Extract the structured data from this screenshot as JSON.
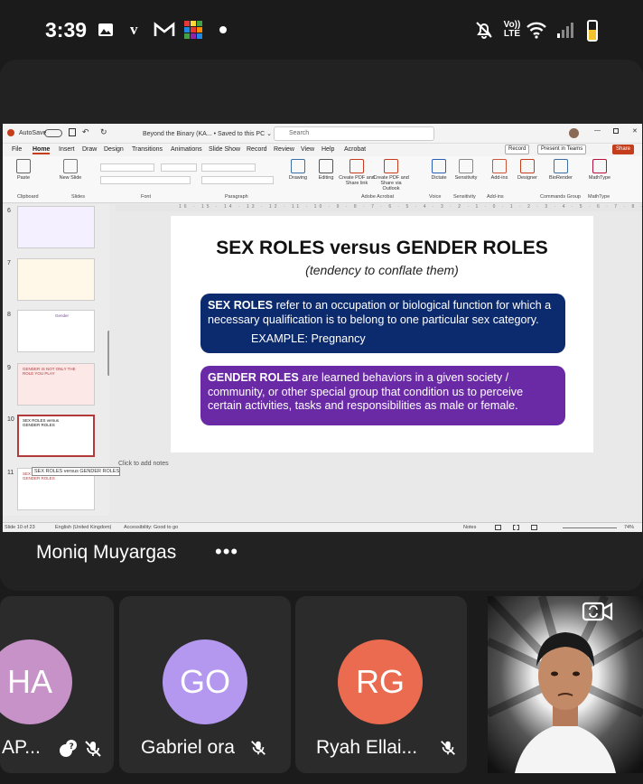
{
  "status_bar": {
    "time": "3:39",
    "indicators": [
      "gallery-icon",
      "v",
      "gmail-icon",
      "app-icon",
      "dot"
    ],
    "right": [
      "mute-icon",
      "VoLTE",
      "wifi-icon",
      "signal-icon",
      "battery-icon"
    ],
    "volte": "Vo)) LTE",
    "v_label": "v",
    "battery_level": 0.55
  },
  "shared_screen": {
    "titlebar": {
      "autosave": "AutoSave",
      "doc_title": "Beyond the Binary (KA... • Saved to this PC ⌄",
      "search_placeholder": "Search"
    },
    "menu": [
      "File",
      "Home",
      "Insert",
      "Draw",
      "Design",
      "Transitions",
      "Animations",
      "Slide Show",
      "Record",
      "Review",
      "View",
      "Help",
      "Acrobat"
    ],
    "menu_active": "Home",
    "menu_right": [
      "Record",
      "Present in Teams",
      "Share"
    ],
    "ribbon_groups": [
      "Clipboard",
      "Slides",
      "Font",
      "Paragraph",
      "Adobe Acrobat",
      "Voice",
      "Sensitivity",
      "Add-ins",
      "Commands Group",
      "MathType"
    ],
    "ribbon_buttons": [
      "Paste",
      "New Slide",
      "Drawing",
      "Editing",
      "Create PDF and Share link",
      "Create PDF and Share via Outlook",
      "Dictate",
      "Sensitivity",
      "Add-ins",
      "Designer",
      "BioRender",
      "MathType"
    ],
    "ruler": "16 · 15 · 14 · 13 · 12 · 11 · 10 · 9 · 8 · 7 · 6 · 5 · 4 · 3 · 2 · 1 · 0 · 1 · 2 · 3 · 4 · 5 · 6 · 7 · 8 · 9 · 10 · 11 · 12 · 13 · 14 · 15 · 16",
    "thumbnails": [
      {
        "num": "6"
      },
      {
        "num": "7"
      },
      {
        "num": "8"
      },
      {
        "num": "9"
      },
      {
        "num": "10",
        "selected": true
      },
      {
        "num": "11"
      }
    ],
    "thumb_texts": {
      "t7": "Gender",
      "t8": "GENDER IS NOT ONLY THE ROLE YOU PLAY",
      "t10": "SEX ROLES versus GENDER ROLES",
      "t11": "SEX ROLES versus GENDER ROLES"
    },
    "tooltip": "SEX ROLES versus GENDER ROLES (...",
    "slide": {
      "title": "SEX ROLES versus GENDER ROLES",
      "subtitle": "(tendency to conflate them)",
      "box1_lead": "SEX ROLES",
      "box1_text": " refer to an occupation or biological function for which a necessary qualification is to belong to one particular sex category.",
      "box1_example": "EXAMPLE: Pregnancy",
      "box2_lead": "GENDER ROLES",
      "box2_text": " are learned behaviors in a given society / community, or other special group that condition us to perceive certain activities, tasks and responsibilities as male or female."
    },
    "notes_placeholder": "Click to add notes",
    "statusline": {
      "slide_count": "Slide 10 of 23",
      "language": "English (United Kingdom)",
      "accessibility": "Accessibility: Good to go",
      "notes": "Notes",
      "zoom": "74%"
    }
  },
  "presenter": {
    "name": "Moniq Muyargas",
    "more": "•••"
  },
  "participants": [
    {
      "initials": "HA",
      "name": "AP...",
      "color": "#c792c8"
    },
    {
      "initials": "GO",
      "name": "Gabriel ora",
      "color": "#b498f0"
    },
    {
      "initials": "RG",
      "name": "Ryah Ellai...",
      "color": "#ea6b4f"
    }
  ],
  "colors": {
    "background": "#1b1b1b",
    "tile": "#2b2b2b",
    "slide_box1": "#0c2a6e",
    "slide_box2": "#6a2aa6",
    "ppt_accent": "#c43e1c"
  }
}
